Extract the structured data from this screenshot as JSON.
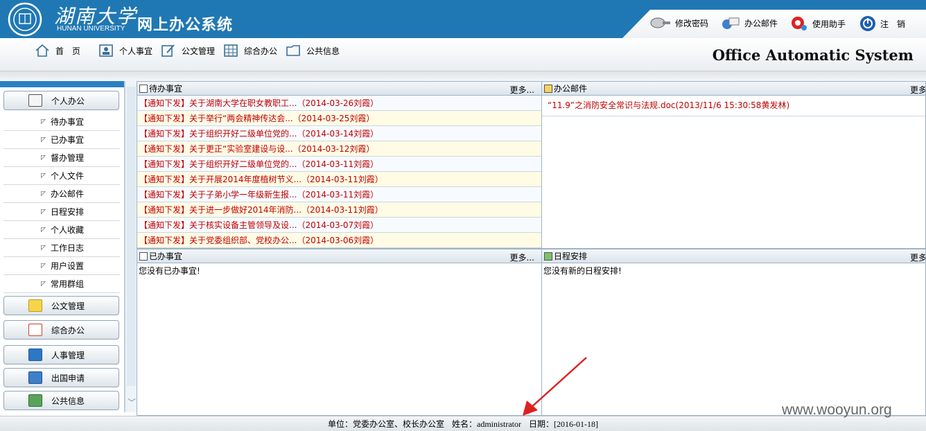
{
  "header": {
    "logo_cn": "湖南大学",
    "logo_en": "HUNAN UNIVERSITY",
    "system_title": "网上办公系统",
    "tools": [
      {
        "label": "修改密码",
        "icon": "key-icon"
      },
      {
        "label": "办公邮件",
        "icon": "mail-icon"
      },
      {
        "label": "使用助手",
        "icon": "help-icon"
      },
      {
        "label": "注　销",
        "icon": "power-icon"
      }
    ]
  },
  "nav": {
    "items": [
      {
        "label": "首　页",
        "icon": "home-icon"
      },
      {
        "label": "个人事宜",
        "icon": "person-icon"
      },
      {
        "label": "公文管理",
        "icon": "edit-icon"
      },
      {
        "label": "综合办公",
        "icon": "grid-icon"
      },
      {
        "label": "公共信息",
        "icon": "folder-icon"
      }
    ],
    "brand": "Office Automatic System"
  },
  "sidebar": {
    "groups": [
      {
        "label": "个人办公",
        "icon": "contact-card-icon"
      },
      {
        "label": "公文管理",
        "icon": "note-icon"
      },
      {
        "label": "综合办公",
        "icon": "checklist-icon"
      },
      {
        "label": "人事管理",
        "icon": "person-silhouette-icon"
      },
      {
        "label": "出国申请",
        "icon": "passport-icon"
      },
      {
        "label": "公共信息",
        "icon": "info-board-icon"
      }
    ],
    "sub_items": [
      "待办事宜",
      "已办事宜",
      "督办管理",
      "个人文件",
      "办公邮件",
      "日程安排",
      "个人收藏",
      "工作日志",
      "用户设置",
      "常用群组"
    ]
  },
  "panels": {
    "todo": {
      "title": "待办事宜",
      "more": "更多...",
      "rows": [
        "【通知下发】关于湖南大学在职女教职工...（2014-03-26刘霞）",
        "【通知下发】关于举行“两会精神传达会...（2014-03-25刘霞）",
        "【通知下发】关于组织开好二级单位党的...（2014-03-14刘霞）",
        "【通知下发】关于更正“实验室建设与设...（2014-03-12刘霞）",
        "【通知下发】关于组织开好二级单位党的...（2014-03-11刘霞）",
        "【通知下发】关于开展2014年度植树节义...（2014-03-11刘霞）",
        "【通知下发】关于子弟小学一年级新生报...（2014-03-11刘霞）",
        "【通知下发】关于进一步做好2014年消防...（2014-03-11刘霞）",
        "【通知下发】关于核实设备主管领导及设...（2014-03-07刘霞）",
        "【通知下发】关于党委组织部、党校办公...（2014-03-06刘霞）"
      ]
    },
    "mail": {
      "title": "办公邮件",
      "more": "更多",
      "rows": [
        "“11.9”之消防安全常识与法规.doc(2013/11/6 15:30:58黄发林)"
      ]
    },
    "done": {
      "title": "已办事宜",
      "more": "更多...",
      "empty": "您没有已办事宜!"
    },
    "schedule": {
      "title": "日程安排",
      "more": "更多",
      "empty": "您没有新的日程安排!"
    }
  },
  "status": {
    "unit_label": "单位：党委办公室、校长办公室",
    "name_label": "姓名：administrator",
    "date_label": "日期：[2016-01-18]"
  },
  "watermark": "www.wooyun.org",
  "colors": {
    "header_blue": "#1f78b4",
    "link_red": "#c00000"
  }
}
